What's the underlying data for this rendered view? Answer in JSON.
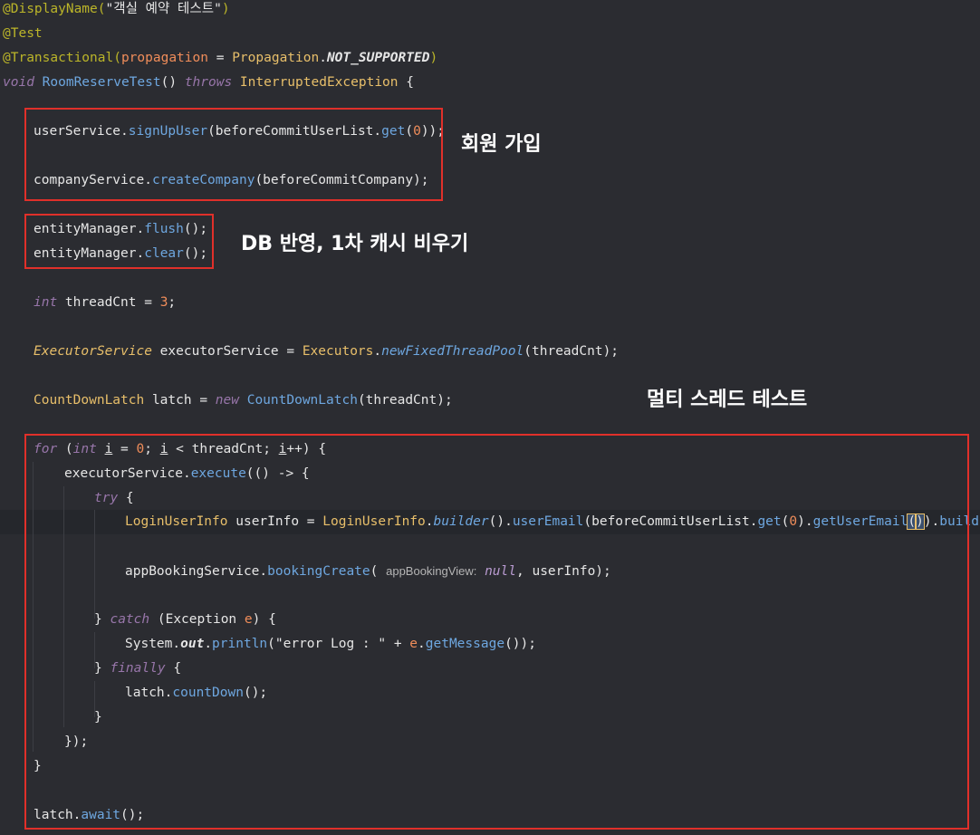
{
  "annotations": {
    "signup": "회원 가입",
    "flush": "DB 반영, 1차 캐시 비우기",
    "multithread": "멀티 스레드 테스트"
  },
  "colors": {
    "background": "#2b2c31",
    "box_border": "#e0302a",
    "keyword": "#9876aa",
    "method": "#6ea7e0",
    "class": "#e8bf6a",
    "number": "#f08d5a"
  },
  "code": {
    "l1": {
      "a": "@DisplayName(",
      "b": "\"객실 예약 테스트\"",
      "c": ")"
    },
    "l2": {
      "a": "@Test"
    },
    "l3": {
      "a": "@Transactional(",
      "b": "propagation",
      "c": " = ",
      "d": "Propagation",
      "e": ".",
      "f": "NOT_SUPPORTED",
      "g": ")"
    },
    "l4": {
      "a": "void ",
      "b": "RoomReserveTest",
      "c": "() ",
      "d": "throws ",
      "e": "InterruptedException",
      "f": " {"
    },
    "l5": {
      "a": "userService",
      "b": ".",
      "c": "signUpUser",
      "d": "(beforeCommitUserList.",
      "e": "get",
      "f": "(",
      "g": "0",
      "h": "));"
    },
    "l6": {
      "a": "companyService",
      "b": ".",
      "c": "createCompany",
      "d": "(beforeCommitCompany);"
    },
    "l7": {
      "a": "entityManager",
      "b": ".",
      "c": "flush",
      "d": "();"
    },
    "l8": {
      "a": "entityManager",
      "b": ".",
      "c": "clear",
      "d": "();"
    },
    "l9": {
      "a": "int ",
      "b": "threadCnt = ",
      "c": "3",
      "d": ";"
    },
    "l10": {
      "a": "ExecutorService",
      "b": " executorService = ",
      "c": "Executors",
      "d": ".",
      "e": "newFixedThreadPool",
      "f": "(threadCnt);"
    },
    "l11": {
      "a": "CountDownLatch",
      "b": " latch = ",
      "c": "new ",
      "d": "CountDownLatch",
      "e": "(threadCnt);"
    },
    "l12": {
      "a": "for ",
      "b": "(",
      "c": "int ",
      "d": "i",
      "e": " = ",
      "f": "0",
      "g": "; ",
      "h": "i",
      "i": " < threadCnt; ",
      "j": "i",
      "k": "++) {"
    },
    "l13": {
      "a": "executorService.",
      "b": "execute",
      "c": "(() -> {"
    },
    "l14": {
      "a": "try ",
      "b": "{"
    },
    "l15": {
      "a": "LoginUserInfo",
      "b": " userInfo = ",
      "c": "LoginUserInfo",
      "d": ".",
      "e": "builder",
      "f": "().",
      "g": "userEmail",
      "h": "(beforeCommitUserList.",
      "i": "get",
      "j": "(",
      "k": "0",
      "l": ").",
      "m": "getUserEmail",
      "n": "(",
      "o": ")",
      "p": ").",
      "q": "build",
      "r": "();"
    },
    "l16": {
      "a": "appBookingService.",
      "b": "bookingCreate",
      "c": "( ",
      "hint": "appBookingView:",
      "d": " null",
      "e": ", userInfo);"
    },
    "l17": {
      "a": "} ",
      "b": "catch ",
      "c": "(Exception ",
      "d": "e",
      "e": ") {"
    },
    "l18": {
      "a": "System.",
      "b": "out",
      "c": ".",
      "d": "println",
      "e": "(\"error Log : \" + ",
      "f": "e",
      "g": ".",
      "h": "getMessage",
      "i": "());"
    },
    "l19": {
      "a": "} ",
      "b": "finally ",
      "c": "{"
    },
    "l20": {
      "a": "latch.",
      "b": "countDown",
      "c": "();"
    },
    "l21": {
      "a": "}"
    },
    "l22": {
      "a": "});"
    },
    "l23": {
      "a": "}"
    },
    "l24": {
      "a": "latch.",
      "b": "await",
      "c": "();"
    }
  }
}
